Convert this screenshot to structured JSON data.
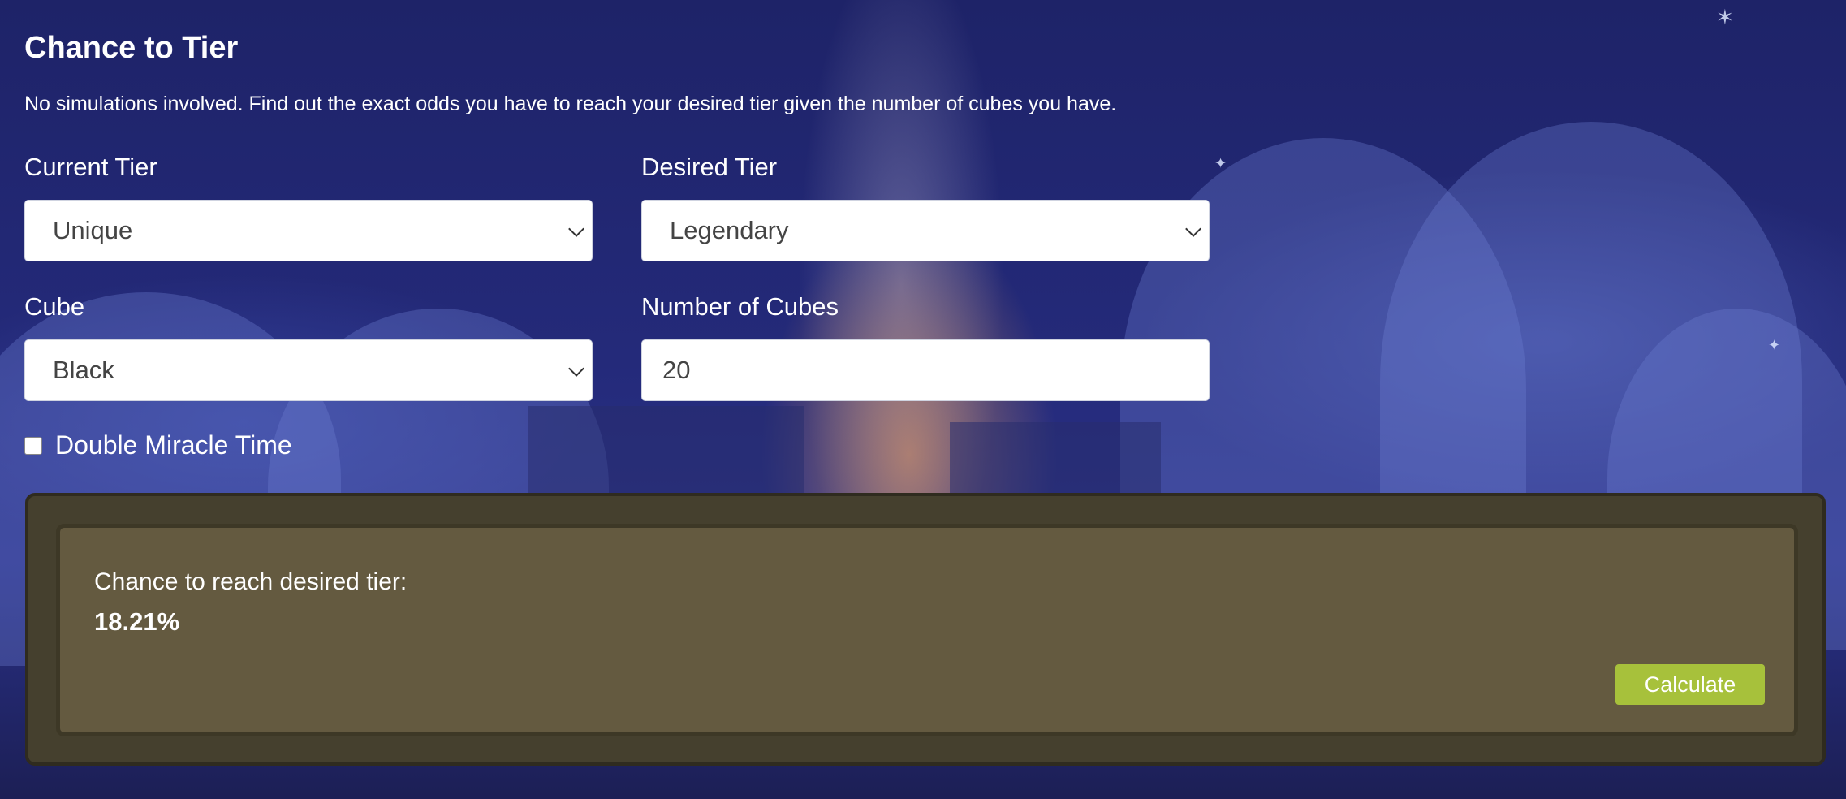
{
  "page": {
    "title": "Chance to Tier",
    "subtitle": "No simulations involved. Find out the exact odds you have to reach your desired tier given the number of cubes you have."
  },
  "form": {
    "current_tier": {
      "label": "Current Tier",
      "value": "Unique"
    },
    "desired_tier": {
      "label": "Desired Tier",
      "value": "Legendary"
    },
    "cube": {
      "label": "Cube",
      "value": "Black"
    },
    "number_of_cubes": {
      "label": "Number of Cubes",
      "value": "20"
    },
    "double_miracle_time": {
      "label": "Double Miracle Time",
      "checked": false
    }
  },
  "result": {
    "label": "Chance to reach desired tier:",
    "value": "18.21%"
  },
  "actions": {
    "calculate_label": "Calculate"
  },
  "colors": {
    "background": "#1f2470",
    "result_outer": "#45402e",
    "result_inner": "#645a40",
    "calculate_button": "#a7c13b"
  },
  "icons": {
    "select_indicator": "chevron-down-icon"
  }
}
